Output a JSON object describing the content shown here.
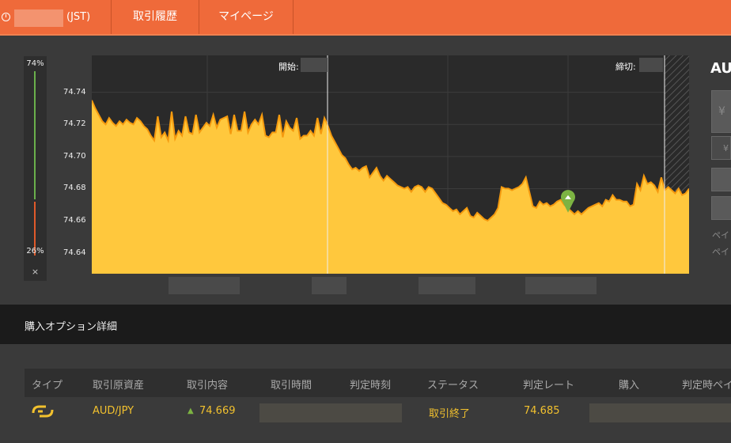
{
  "topbar": {
    "time_suffix": "(JST)",
    "tab_history": "取引履歴",
    "tab_mypage": "マイページ"
  },
  "meter": {
    "top_percent": "74%",
    "bottom_percent": "26%",
    "close_glyph": "×",
    "bullish_fraction": 0.74,
    "bearish_fraction": 0.26
  },
  "chart_data": {
    "type": "area",
    "start_label": "開始:",
    "end_label": "締切:",
    "ylim": [
      74.627,
      74.763
    ],
    "yticks": [
      "74.74",
      "74.72",
      "74.70",
      "74.68",
      "74.66",
      "74.64"
    ],
    "grid": true,
    "colors": {
      "fill": "#ffc83d",
      "line": "#f59a0e",
      "background": "#2a2a2a",
      "marker": "#7cb342"
    },
    "purchase_marker_level": 74.669,
    "values": [
      74.735,
      74.73,
      74.726,
      74.722,
      74.72,
      74.724,
      74.721,
      74.719,
      74.722,
      74.72,
      74.723,
      74.721,
      74.72,
      74.724,
      74.722,
      74.719,
      74.717,
      74.713,
      74.71,
      74.725,
      74.712,
      74.715,
      74.71,
      74.728,
      74.711,
      74.716,
      74.713,
      74.725,
      74.715,
      74.714,
      74.726,
      74.715,
      74.718,
      74.721,
      74.719,
      74.726,
      74.718,
      74.723,
      74.724,
      74.725,
      74.714,
      74.726,
      74.716,
      74.716,
      74.728,
      74.715,
      74.72,
      74.723,
      74.72,
      74.726,
      74.713,
      74.712,
      74.715,
      74.715,
      74.726,
      74.712,
      74.722,
      74.718,
      74.716,
      74.724,
      74.711,
      74.713,
      74.713,
      74.716,
      74.713,
      74.724,
      74.714,
      74.724,
      74.719,
      74.713,
      74.709,
      74.705,
      74.701,
      74.699,
      74.695,
      74.692,
      74.693,
      74.691,
      74.693,
      74.694,
      74.687,
      74.69,
      74.693,
      74.688,
      74.685,
      74.688,
      74.686,
      74.684,
      74.682,
      74.681,
      74.68,
      74.681,
      74.678,
      74.681,
      74.682,
      74.681,
      74.678,
      74.681,
      74.68,
      74.677,
      74.674,
      74.671,
      74.67,
      74.668,
      74.666,
      74.667,
      74.664,
      74.666,
      74.668,
      74.663,
      74.662,
      74.665,
      74.663,
      74.661,
      74.66,
      74.662,
      74.664,
      74.668,
      74.681,
      74.68,
      74.68,
      74.679,
      74.68,
      74.681,
      74.683,
      74.687,
      74.678,
      74.669,
      74.668,
      74.672,
      74.67,
      74.671,
      74.669,
      74.67,
      74.672,
      74.673,
      74.67,
      74.668,
      74.666,
      74.664,
      74.666,
      74.664,
      74.666,
      74.668,
      74.669,
      74.67,
      74.671,
      74.669,
      74.673,
      74.672,
      74.676,
      74.673,
      74.673,
      74.672,
      74.672,
      74.669,
      74.67,
      74.683,
      74.679,
      74.688,
      74.683,
      74.684,
      74.682,
      74.678,
      74.687,
      74.679,
      74.681,
      74.679,
      74.677,
      74.68,
      74.676,
      74.677,
      74.68
    ]
  },
  "side_panel": {
    "pair_cut": "AU",
    "yen_cut": "¥",
    "yen_cut2": "¥",
    "payout_cut1": "ペイ",
    "payout_cut2": "ペイ"
  },
  "details": {
    "title": "購入オプション詳細"
  },
  "table": {
    "headers": [
      "タイプ",
      "取引原資産",
      "取引内容",
      "取引時間",
      "判定時刻",
      "ステータス",
      "判定レート",
      "購入",
      "判定時ペイ"
    ],
    "row": {
      "asset": "AUD/JPY",
      "direction_glyph": "▲",
      "entry_rate": "74.669",
      "status": "取引終了",
      "judge_rate": "74.685"
    }
  }
}
